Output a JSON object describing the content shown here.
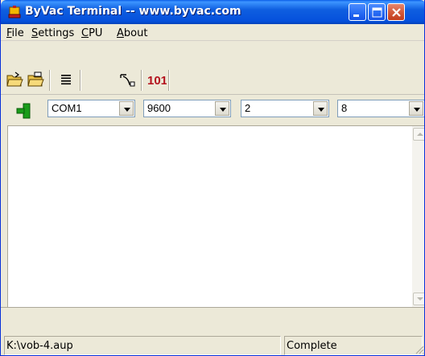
{
  "window": {
    "title": "ByVac Terminal -- www.byvac.com"
  },
  "menu": [
    {
      "label": "File",
      "mnemonic": "F",
      "rest": "ile"
    },
    {
      "label": "Settings",
      "mnemonic": "S",
      "rest": "ettings"
    },
    {
      "label": "CPU",
      "mnemonic": "C",
      "rest": "PU"
    },
    {
      "label": "About",
      "mnemonic": "A",
      "rest": "bout"
    }
  ],
  "toolbar": {
    "icons": [
      "open-folder-icon",
      "save-folder-icon",
      "text-lines-icon",
      "cable-icon",
      "binary-101-icon"
    ],
    "binary_label": "101"
  },
  "settings": {
    "port": "COM1",
    "baud": "9600",
    "stop_bits": "2",
    "data_bits": "8"
  },
  "terminal": {
    "content": ""
  },
  "status": {
    "file": "K:\\vob-4.aup",
    "state": "Complete"
  },
  "colors": {
    "title_bar": "#0550dc",
    "close_button": "#d35a3a",
    "window_face": "#ece9d8",
    "connect_green": "#1a9c1a",
    "binary_red": "#b4121e"
  }
}
